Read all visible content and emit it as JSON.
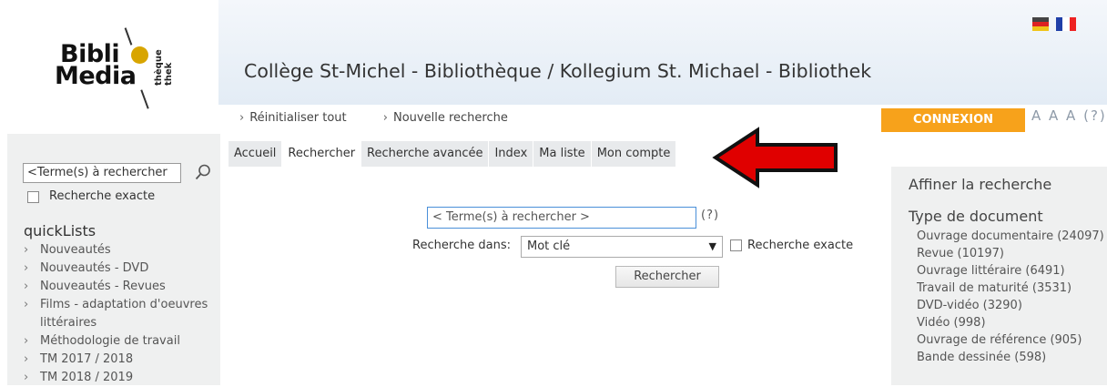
{
  "logo": {
    "line1": "Bibli",
    "line1_o": "o",
    "line2": "Media",
    "vertical_text_1": "thèque",
    "vertical_text_2": "thek"
  },
  "site_title": "Collège St-Michel - Bibliothèque / Kollegium St. Michael - Bibliothek",
  "flags": [
    "de-flag",
    "fr-flag"
  ],
  "subnav": {
    "reset": "Réinitialiser tout",
    "new_search": "Nouvelle recherche"
  },
  "connexion_label": "CONNEXION",
  "font_sizes": "A A A (?)",
  "sidebar": {
    "search_placeholder": "<Terme(s) à rechercher",
    "exact_label": "Recherche exacte",
    "quicklists_title": "quickLists",
    "items": [
      "Nouveautés",
      "Nouveautés - DVD",
      "Nouveautés - Revues",
      "Films - adaptation d'oeuvres littéraires",
      "Méthodologie de travail",
      "TM 2017 / 2018",
      "TM 2018 / 2019"
    ]
  },
  "tabs": [
    {
      "label": "Accueil",
      "active": false
    },
    {
      "label": "Rechercher",
      "active": true
    },
    {
      "label": "Recherche avancée",
      "active": false
    },
    {
      "label": "Index",
      "active": false
    },
    {
      "label": "Ma liste",
      "active": false
    },
    {
      "label": "Mon compte",
      "active": false
    }
  ],
  "main": {
    "search_placeholder": "< Terme(s) à rechercher >",
    "help": "(?)",
    "search_in_label": "Recherche dans:",
    "search_in_value": "Mot clé",
    "exact_label": "Recherche exacte",
    "search_button": "Rechercher"
  },
  "facets": {
    "title": "Affiner la recherche",
    "group_title": "Type de document",
    "items": [
      "Ouvrage documentaire (24097)",
      "Revue (10197)",
      "Ouvrage littéraire (6491)",
      "Travail de maturité (3531)",
      "DVD-vidéo (3290)",
      "Vidéo (998)",
      "Ouvrage de référence (905)",
      "Bande dessinée (598)"
    ]
  },
  "colors": {
    "connexion": "#f7a21b",
    "arrow": "#e00000",
    "logo_accent": "#d8a500"
  }
}
